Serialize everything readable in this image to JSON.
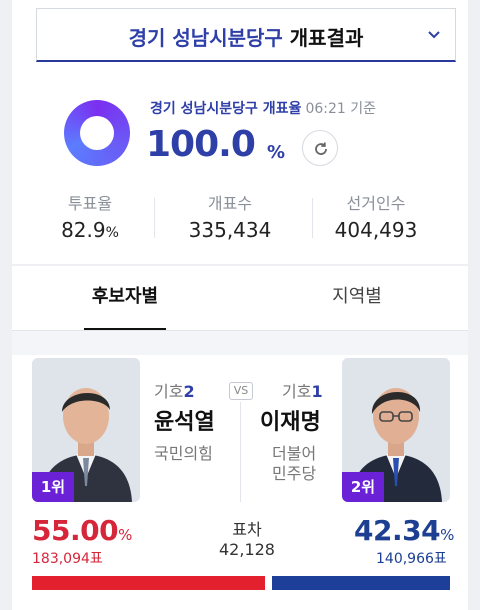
{
  "header": {
    "region": "경기 성남시분당구",
    "suffix": "개표결과"
  },
  "count": {
    "label": "경기 성남시분당구 개표율",
    "time": "06:21 기준",
    "percent": "100.0",
    "unit": "%"
  },
  "stats": [
    {
      "label": "투표율",
      "value": "82.9",
      "unit": "%"
    },
    {
      "label": "개표수",
      "value": "335,434",
      "unit": ""
    },
    {
      "label": "선거인수",
      "value": "404,493",
      "unit": ""
    }
  ],
  "tabs": [
    {
      "label": "후보자별",
      "active": true
    },
    {
      "label": "지역별",
      "active": false
    }
  ],
  "candidates": [
    {
      "symbol_prefix": "기호",
      "symbol_num": "2",
      "name": "윤석열",
      "party": "국민의힘",
      "rank": "1위",
      "percent": "55.00",
      "pct_unit": "%",
      "votes": "183,094표",
      "color": "#e3202e"
    },
    {
      "symbol_prefix": "기호",
      "symbol_num": "1",
      "name": "이재명",
      "party_line1": "더불어",
      "party_line2": "민주당",
      "rank": "2위",
      "percent": "42.34",
      "pct_unit": "%",
      "votes": "140,966표",
      "color": "#1d3f9a"
    }
  ],
  "vs": "VS",
  "margin": {
    "label": "표차",
    "value": "42,128"
  }
}
